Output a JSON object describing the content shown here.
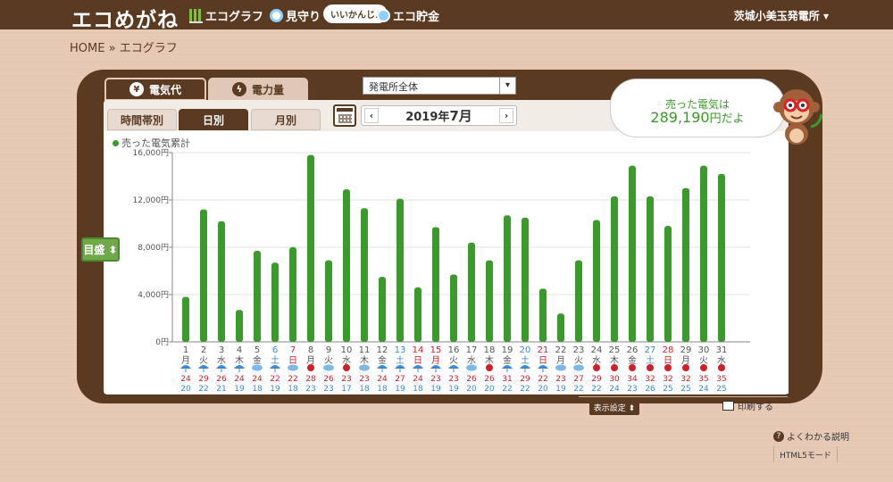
{
  "header": {
    "logo": "エコめがね",
    "nav": [
      {
        "label": "エコグラフ",
        "icon": "bar-chart-icon"
      },
      {
        "label": "見守り",
        "icon": "magnifier-icon"
      },
      {
        "label": "エコ貯金",
        "icon": "coin-icon"
      }
    ],
    "bubble": "いいかんじ♪",
    "place": "茨城小美玉発電所 ▾"
  },
  "breadcrumb": {
    "home": "HOME",
    "sep": "»",
    "current": "エコグラフ"
  },
  "tabs": [
    {
      "label": "電気代",
      "icon": "yen-icon",
      "active": true
    },
    {
      "label": "電力量",
      "icon": "bolt-icon",
      "active": false
    }
  ],
  "plant_select": {
    "value": "発電所全体"
  },
  "subtabs": [
    {
      "label": "時間帯別",
      "active": false
    },
    {
      "label": "日別",
      "active": true
    },
    {
      "label": "月別",
      "active": false
    }
  ],
  "period": {
    "year": "2019年",
    "month": "7月",
    "prev": "‹",
    "next": "›"
  },
  "metric_button": "目盛 ⬍",
  "speech": {
    "line1": "売った電気は",
    "amount": "289,190",
    "unit": "円だよ"
  },
  "buttons": {
    "display_settings": "表示設定 ⬍",
    "print": "印刷する"
  },
  "help": "よくわかる説明",
  "html5": "HTML5モード",
  "colors": {
    "brown": "#5b3a22",
    "bar": "#3a9a2a",
    "saturday": "#3a8ad8",
    "sunday": "#d0202a",
    "hot": "#d0202a"
  },
  "chart_data": {
    "type": "bar",
    "title": "",
    "legend": [
      "売った電気累計"
    ],
    "ylabel": "",
    "ylim": [
      0,
      16000
    ],
    "yticks": [
      "0円",
      "4,000円",
      "8,000円",
      "12,000円",
      "16,000円"
    ],
    "categories": [
      "1",
      "2",
      "3",
      "4",
      "5",
      "6",
      "7",
      "8",
      "9",
      "10",
      "11",
      "12",
      "13",
      "14",
      "15",
      "16",
      "17",
      "18",
      "19",
      "20",
      "21",
      "22",
      "23",
      "24",
      "25",
      "26",
      "27",
      "28",
      "29",
      "30",
      "31"
    ],
    "weekdays": [
      "月",
      "火",
      "水",
      "木",
      "金",
      "土",
      "日",
      "月",
      "火",
      "水",
      "木",
      "金",
      "土",
      "日",
      "月",
      "火",
      "水",
      "木",
      "金",
      "土",
      "日",
      "月",
      "火",
      "水",
      "木",
      "金",
      "土",
      "日",
      "月",
      "火",
      "水"
    ],
    "holidays": [
      15
    ],
    "values": [
      3800,
      11200,
      10200,
      2700,
      7700,
      6700,
      8000,
      15800,
      6900,
      12900,
      11300,
      5500,
      12100,
      4600,
      9700,
      5700,
      8400,
      6900,
      10700,
      10500,
      4500,
      2400,
      6900,
      10300,
      12300,
      14900,
      12300,
      9800,
      13000,
      14900,
      14200
    ],
    "weather": [
      "rain",
      "rain",
      "rain",
      "rain",
      "cloud",
      "rain",
      "cloud",
      "sun",
      "cloud",
      "sun",
      "cloud",
      "rain",
      "rain",
      "rain",
      "rain",
      "rain",
      "cloud",
      "sun",
      "rain",
      "rain",
      "rain",
      "cloud",
      "cloud",
      "sun",
      "sun",
      "sun",
      "sun",
      "sun",
      "sun",
      "sun",
      "sun"
    ],
    "temp_high": [
      24,
      29,
      26,
      24,
      24,
      22,
      22,
      28,
      26,
      23,
      23,
      24,
      27,
      24,
      23,
      23,
      26,
      26,
      31,
      29,
      22,
      23,
      27,
      29,
      30,
      34,
      32,
      32,
      32,
      35,
      35
    ],
    "temp_low": [
      20,
      22,
      21,
      19,
      18,
      19,
      18,
      23,
      23,
      17,
      18,
      18,
      19,
      18,
      19,
      19,
      20,
      20,
      22,
      22,
      20,
      19,
      22,
      22,
      24,
      23,
      26,
      25,
      25,
      24,
      25
    ]
  }
}
